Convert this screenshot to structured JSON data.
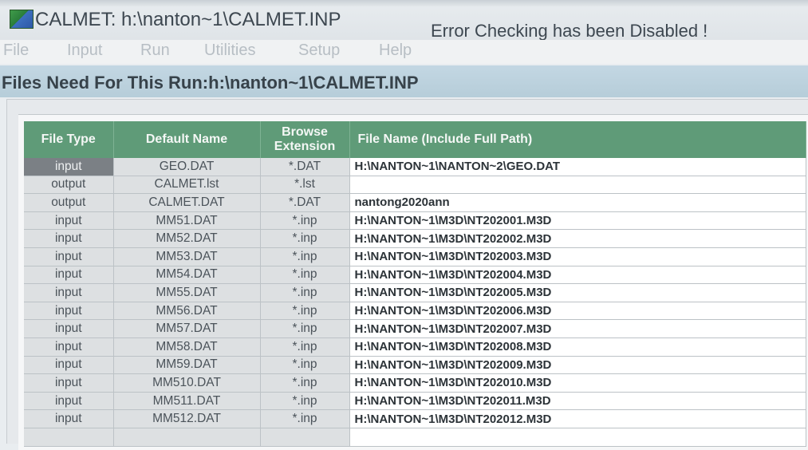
{
  "window": {
    "title": "CALMET: h:\\nanton~1\\CALMET.INP",
    "status": "Error Checking has been Disabled !"
  },
  "menu": [
    "File",
    "Input",
    "Run",
    "Utilities",
    "Setup",
    "Help"
  ],
  "files_header": "Files Need For This Run:h:\\nanton~1\\CALMET.INP",
  "table": {
    "columns": {
      "type": "File Type",
      "default": "Default Name",
      "browse": "Browse Extension",
      "path": "File Name (Include Full Path)"
    },
    "rows": [
      {
        "type": "input",
        "default": "GEO.DAT",
        "ext": "*.DAT",
        "path": "H:\\NANTON~1\\NANTON~2\\GEO.DAT"
      },
      {
        "type": "output",
        "default": "CALMET.lst",
        "ext": "*.lst",
        "path": ""
      },
      {
        "type": "output",
        "default": "CALMET.DAT",
        "ext": "*.DAT",
        "path": "nantong2020ann"
      },
      {
        "type": "input",
        "default": "MM51.DAT",
        "ext": "*.inp",
        "path": "H:\\NANTON~1\\M3D\\NT202001.M3D"
      },
      {
        "type": "input",
        "default": "MM52.DAT",
        "ext": "*.inp",
        "path": "H:\\NANTON~1\\M3D\\NT202002.M3D"
      },
      {
        "type": "input",
        "default": "MM53.DAT",
        "ext": "*.inp",
        "path": "H:\\NANTON~1\\M3D\\NT202003.M3D"
      },
      {
        "type": "input",
        "default": "MM54.DAT",
        "ext": "*.inp",
        "path": "H:\\NANTON~1\\M3D\\NT202004.M3D"
      },
      {
        "type": "input",
        "default": "MM55.DAT",
        "ext": "*.inp",
        "path": "H:\\NANTON~1\\M3D\\NT202005.M3D"
      },
      {
        "type": "input",
        "default": "MM56.DAT",
        "ext": "*.inp",
        "path": "H:\\NANTON~1\\M3D\\NT202006.M3D"
      },
      {
        "type": "input",
        "default": "MM57.DAT",
        "ext": "*.inp",
        "path": "H:\\NANTON~1\\M3D\\NT202007.M3D"
      },
      {
        "type": "input",
        "default": "MM58.DAT",
        "ext": "*.inp",
        "path": "H:\\NANTON~1\\M3D\\NT202008.M3D"
      },
      {
        "type": "input",
        "default": "MM59.DAT",
        "ext": "*.inp",
        "path": "H:\\NANTON~1\\M3D\\NT202009.M3D"
      },
      {
        "type": "input",
        "default": "MM510.DAT",
        "ext": "*.inp",
        "path": "H:\\NANTON~1\\M3D\\NT202010.M3D"
      },
      {
        "type": "input",
        "default": "MM511.DAT",
        "ext": "*.inp",
        "path": "H:\\NANTON~1\\M3D\\NT202011.M3D"
      },
      {
        "type": "input",
        "default": "MM512.DAT",
        "ext": "*.inp",
        "path": "H:\\NANTON~1\\M3D\\NT202012.M3D"
      }
    ]
  }
}
